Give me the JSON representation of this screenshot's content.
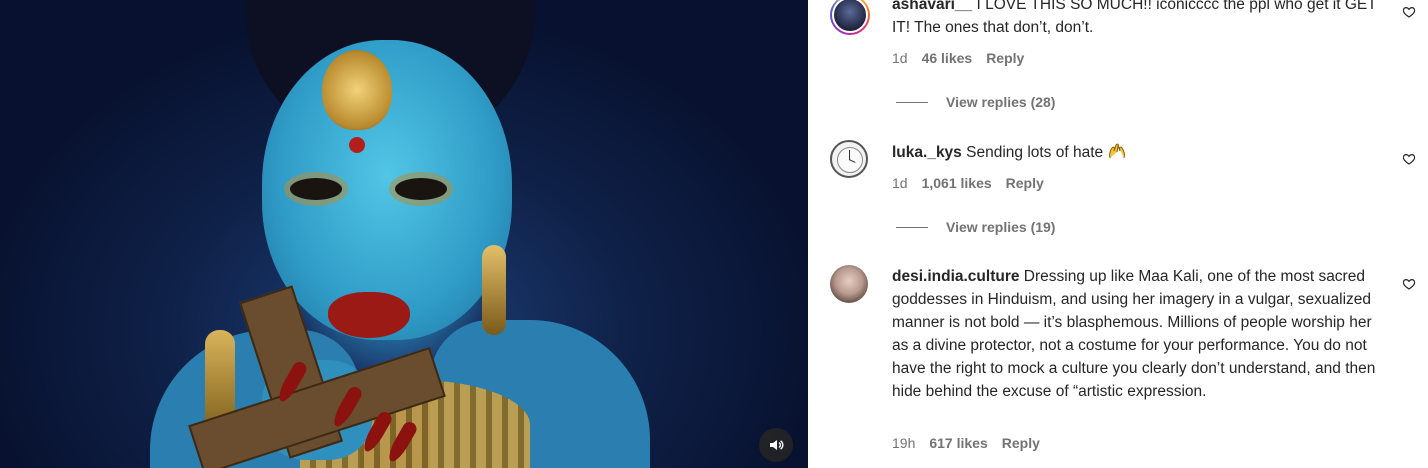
{
  "video": {
    "sound_icon": "speaker-icon"
  },
  "comments": [
    {
      "username": "ashavari__",
      "text": "I LOVE THIS SO MUCH!! iconicccc the ppl who get it GET IT! The ones that don’t, don’t.",
      "time": "1d",
      "likes": "46 likes",
      "reply_label": "Reply",
      "view_replies": "View replies (28)"
    },
    {
      "username": "luka._kys",
      "text": "Sending lots of hate",
      "emoji": "raising-hands-emoji",
      "time": "1d",
      "likes": "1,061 likes",
      "reply_label": "Reply",
      "view_replies": "View replies (19)"
    },
    {
      "username": "desi.india.culture",
      "text": "Dressing up like Maa Kali, one of the most sacred goddesses in Hinduism, and using her imagery in a vulgar, sexualized manner is not bold — it’s blasphemous. Millions of people worship her as a divine protector, not a costume for your performance. You do not have the right to mock a culture you clearly don’t understand, and then hide behind the excuse of “artistic expression.",
      "time": "19h",
      "likes": "617 likes",
      "reply_label": "Reply"
    }
  ],
  "colors": {
    "text_primary": "#262626",
    "text_secondary": "#737373",
    "video_bg": "#0f2148"
  }
}
